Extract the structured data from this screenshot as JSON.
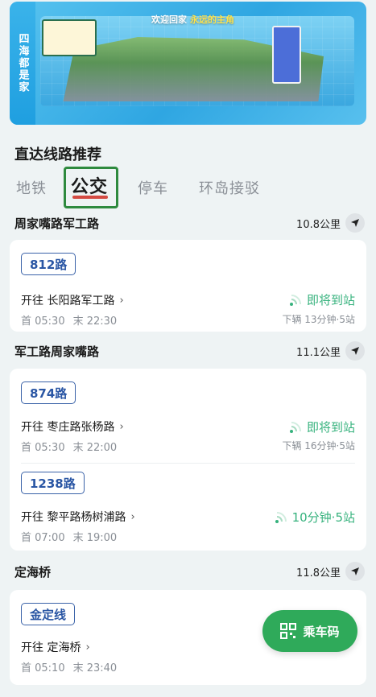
{
  "banner": {
    "side_text": "四海都是家",
    "headline": "欢迎回家",
    "headline_sub": "永远的主角"
  },
  "section_title": "直达线路推荐",
  "tabs": [
    {
      "label": "地铁",
      "active": false
    },
    {
      "label": "公交",
      "active": true
    },
    {
      "label": "停车",
      "active": false
    },
    {
      "label": "环岛接驳",
      "active": false
    }
  ],
  "stops": [
    {
      "name": "周家嘴路军工路",
      "distance": "10.8公里",
      "routes": [
        {
          "route": "812路",
          "direction": "开往 长阳路军工路",
          "first": "首 05:30",
          "last": "末 22:30",
          "status": "即将到站",
          "next": "下辆 13分钟·5站"
        }
      ]
    },
    {
      "name": "军工路周家嘴路",
      "distance": "11.1公里",
      "routes": [
        {
          "route": "874路",
          "direction": "开往 枣庄路张杨路",
          "first": "首 05:30",
          "last": "末 22:00",
          "status": "即将到站",
          "next": "下辆 16分钟·5站"
        },
        {
          "route": "1238路",
          "direction": "开往 黎平路杨树浦路",
          "first": "首 07:00",
          "last": "末 19:00",
          "status": "10分钟·5站",
          "next": ""
        }
      ]
    },
    {
      "name": "定海桥",
      "distance": "11.8公里",
      "routes": [
        {
          "route": "金定线",
          "direction": "开往 定海桥",
          "first": "首 05:10",
          "last": "末 23:40",
          "status": "",
          "next": ""
        }
      ]
    }
  ],
  "qr_button": {
    "label": "乘车码"
  },
  "colors": {
    "accent_green": "#36b27d",
    "route_blue": "#2a56a4",
    "tab_underline": "#d44a42",
    "qr_button": "#2faa5a"
  }
}
